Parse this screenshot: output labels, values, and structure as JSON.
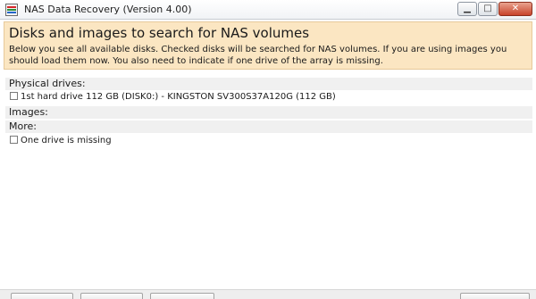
{
  "window": {
    "title": "NAS Data Recovery (Version 4.00)"
  },
  "header": {
    "title": "Disks and images to search for NAS volumes",
    "description": "Below you see all available disks. Checked disks will be searched for NAS volumes. If you are using images you should load them now. You also need to indicate if one drive of the array is missing."
  },
  "sections": {
    "physical_drives": "Physical drives:",
    "images": "Images:",
    "more": "More:"
  },
  "drives": [
    {
      "label": "1st hard drive 112 GB (DISK0:) - KINGSTON SV300S37A120G (112 GB)",
      "checked": false
    }
  ],
  "options": {
    "one_drive_missing": {
      "label": "One drive is missing",
      "checked": false
    }
  },
  "colors": {
    "header_background": "#fbe6c2",
    "close_button": "#c8432a"
  }
}
